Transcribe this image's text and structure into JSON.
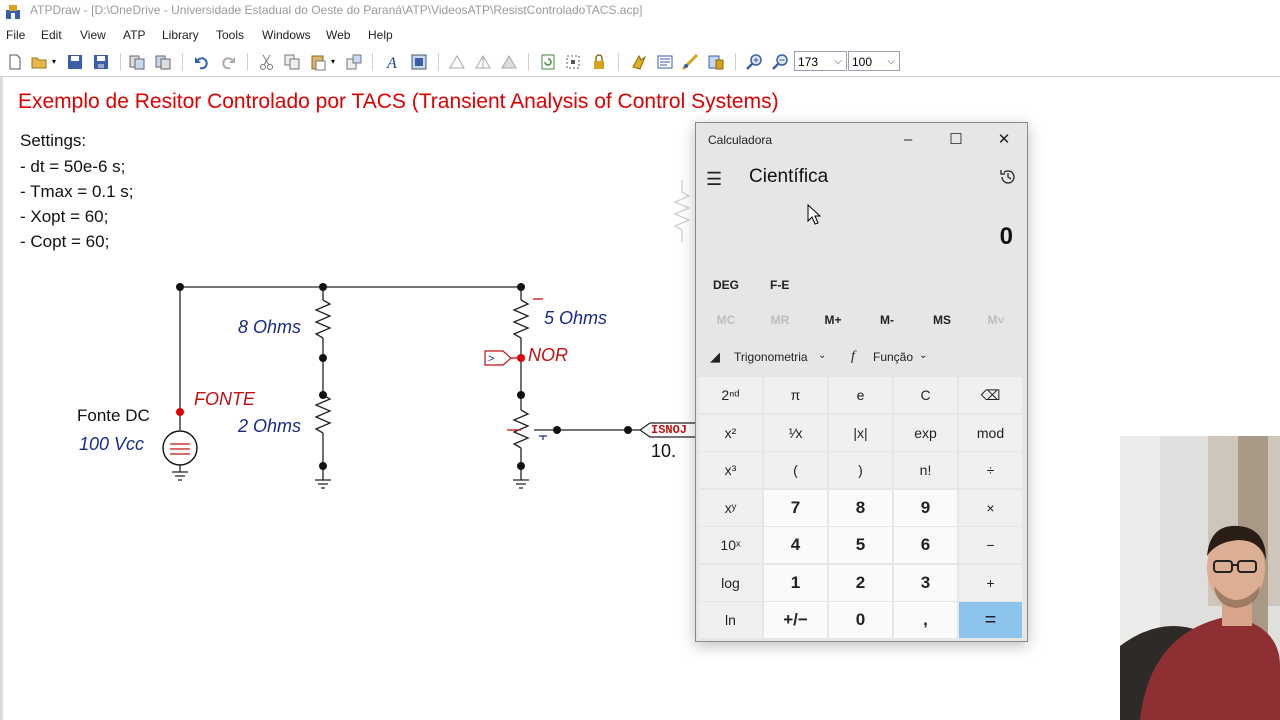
{
  "window": {
    "title": "ATPDraw - [D:\\OneDrive - Universidade Estadual do Oeste do Paraná\\ATP\\VideosATP\\ResistControladoTACS.acp]"
  },
  "menu": [
    "File",
    "Edit",
    "View",
    "ATP",
    "Library",
    "Tools",
    "Windows",
    "Web",
    "Help"
  ],
  "toolbar": {
    "zoom_value": "173",
    "grid_value": "100"
  },
  "canvas": {
    "heading": "Exemplo de Resitor Controlado por TACS (Transient Analysis of Control Systems)",
    "settings_title": "Settings:",
    "settings": [
      " - dt = 50e-6 s;",
      " - Tmax = 0.1 s;",
      " - Xopt = 60;",
      " - Copt = 60;"
    ],
    "labels": {
      "r8": "8 Ohms",
      "r2": "2 Ohms",
      "r5": "5 Ohms",
      "nor": "NOR",
      "fonte": "FONTE",
      "fonte_dc": "Fonte DC",
      "vcc": "100 Vcc",
      "isnoj": "ISNOJ",
      "val10": "10."
    }
  },
  "calculator": {
    "window_title": "Calculadora",
    "mode": "Científica",
    "display": "0",
    "deg": "DEG",
    "fe": "F-E",
    "memory": [
      "MC",
      "MR",
      "M+",
      "M-",
      "MS",
      "M˅"
    ],
    "memory_disabled": [
      true,
      true,
      false,
      false,
      false,
      true
    ],
    "trig_label": "Trigonometria",
    "func_label": "Função",
    "keys": [
      [
        "2ⁿᵈ",
        "π",
        "e",
        "C",
        "⌫"
      ],
      [
        "x²",
        "¹⁄x",
        "|x|",
        "exp",
        "mod"
      ],
      [
        "x³",
        "(",
        ")",
        "n!",
        "÷"
      ],
      [
        "xʸ",
        "7",
        "8",
        "9",
        "×"
      ],
      [
        "10ˣ",
        "4",
        "5",
        "6",
        "−"
      ],
      [
        "log",
        "1",
        "2",
        "3",
        "+"
      ],
      [
        "ln",
        "+/−",
        "0",
        ",",
        "="
      ]
    ]
  },
  "colors": {
    "heading": "#e00000",
    "component_label": "#1a2a8a",
    "node_label": "#c01010",
    "equals_key": "#8cc4ee"
  }
}
